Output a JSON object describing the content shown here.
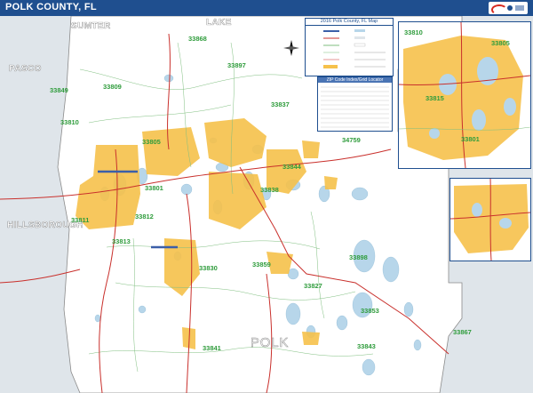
{
  "header": {
    "title": "POLK COUNTY, FL",
    "title_bar_color": "#1f4f8f"
  },
  "map": {
    "background_color": "#dfe5ea",
    "county_fill": "#ffffff",
    "urban_color": "#f6c14b",
    "water_color": "#b7d6ea",
    "road_major_color": "#c9302c",
    "road_minor_color": "#7fbf7f",
    "neighbor_counties": [
      {
        "id": "sumter",
        "label": "SUMTER"
      },
      {
        "id": "lake",
        "label": "LAKE"
      },
      {
        "id": "pasco",
        "label": "PASCO"
      },
      {
        "id": "hillsborough",
        "label": "HILLSBOROUGH"
      }
    ],
    "county_label": "POLK",
    "zip_codes": [
      {
        "id": "z33868",
        "code": "33868"
      },
      {
        "id": "z33897",
        "code": "33897"
      },
      {
        "id": "z33849",
        "code": "33849"
      },
      {
        "id": "z33809",
        "code": "33809"
      },
      {
        "id": "z33810",
        "code": "33810"
      },
      {
        "id": "z33805",
        "code": "33805"
      },
      {
        "id": "z33837",
        "code": "33837"
      },
      {
        "id": "z34759",
        "code": "34759"
      },
      {
        "id": "z33844",
        "code": "33844"
      },
      {
        "id": "z33801",
        "code": "33801"
      },
      {
        "id": "z33838",
        "code": "33838"
      },
      {
        "id": "z33813",
        "code": "33813"
      },
      {
        "id": "z33812",
        "code": "33812"
      },
      {
        "id": "z33811",
        "code": "33811"
      },
      {
        "id": "z33830",
        "code": "33830"
      },
      {
        "id": "z33859",
        "code": "33859"
      },
      {
        "id": "z33898",
        "code": "33898"
      },
      {
        "id": "z33827",
        "code": "33827"
      },
      {
        "id": "z33853",
        "code": "33853"
      },
      {
        "id": "z33841",
        "code": "33841"
      },
      {
        "id": "z33843",
        "code": "33843"
      },
      {
        "id": "z33867",
        "code": "33867"
      }
    ],
    "inset_zip_codes": [
      {
        "id": "i33810",
        "code": "33810"
      },
      {
        "id": "i33805",
        "code": "33805"
      },
      {
        "id": "i33815",
        "code": "33815"
      },
      {
        "id": "i33801",
        "code": "33801"
      }
    ]
  },
  "legend": {
    "title": "2016 Polk County, FL Map"
  },
  "zip_index": {
    "title": "ZIP Code Index/Grid Locator"
  },
  "compass": {
    "north": "N"
  }
}
